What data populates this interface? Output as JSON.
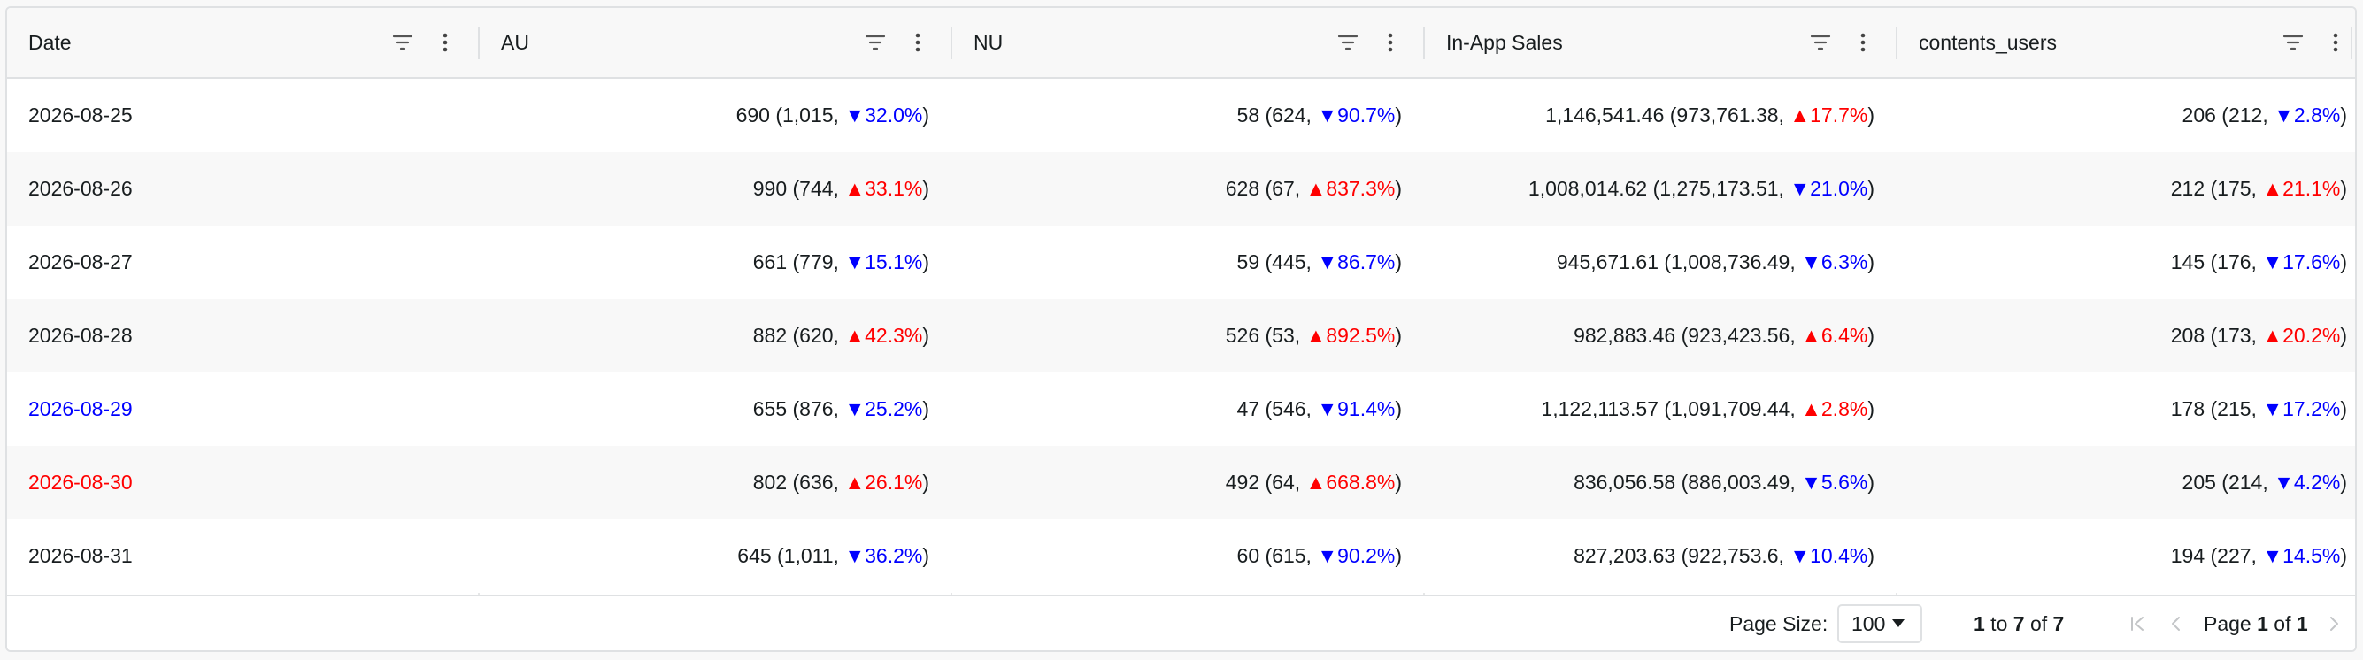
{
  "columns": [
    {
      "label": "Date"
    },
    {
      "label": "AU"
    },
    {
      "label": "NU"
    },
    {
      "label": "In-App Sales"
    },
    {
      "label": "contents_users"
    }
  ],
  "rows": [
    {
      "date": "2026-08-25",
      "date_color": "",
      "cells": [
        {
          "base": "690 (1,015, ",
          "dir": "down",
          "arrow": "▼",
          "pct": "32.0%",
          "close": ")"
        },
        {
          "base": "58 (624, ",
          "dir": "down",
          "arrow": "▼",
          "pct": "90.7%",
          "close": ")"
        },
        {
          "base": "1,146,541.46 (973,761.38, ",
          "dir": "up",
          "arrow": "▲",
          "pct": "17.7%",
          "close": ")"
        },
        {
          "base": "206 (212, ",
          "dir": "down",
          "arrow": "▼",
          "pct": "2.8%",
          "close": ")"
        }
      ]
    },
    {
      "date": "2026-08-26",
      "date_color": "",
      "cells": [
        {
          "base": "990 (744, ",
          "dir": "up",
          "arrow": "▲",
          "pct": "33.1%",
          "close": ")"
        },
        {
          "base": "628 (67, ",
          "dir": "up",
          "arrow": "▲",
          "pct": "837.3%",
          "close": ")"
        },
        {
          "base": "1,008,014.62 (1,275,173.51, ",
          "dir": "down",
          "arrow": "▼",
          "pct": "21.0%",
          "close": ")"
        },
        {
          "base": "212 (175, ",
          "dir": "up",
          "arrow": "▲",
          "pct": "21.1%",
          "close": ")"
        }
      ]
    },
    {
      "date": "2026-08-27",
      "date_color": "",
      "cells": [
        {
          "base": "661 (779, ",
          "dir": "down",
          "arrow": "▼",
          "pct": "15.1%",
          "close": ")"
        },
        {
          "base": "59 (445, ",
          "dir": "down",
          "arrow": "▼",
          "pct": "86.7%",
          "close": ")"
        },
        {
          "base": "945,671.61 (1,008,736.49, ",
          "dir": "down",
          "arrow": "▼",
          "pct": "6.3%",
          "close": ")"
        },
        {
          "base": "145 (176, ",
          "dir": "down",
          "arrow": "▼",
          "pct": "17.6%",
          "close": ")"
        }
      ]
    },
    {
      "date": "2026-08-28",
      "date_color": "",
      "cells": [
        {
          "base": "882 (620, ",
          "dir": "up",
          "arrow": "▲",
          "pct": "42.3%",
          "close": ")"
        },
        {
          "base": "526 (53, ",
          "dir": "up",
          "arrow": "▲",
          "pct": "892.5%",
          "close": ")"
        },
        {
          "base": "982,883.46 (923,423.56, ",
          "dir": "up",
          "arrow": "▲",
          "pct": "6.4%",
          "close": ")"
        },
        {
          "base": "208 (173, ",
          "dir": "up",
          "arrow": "▲",
          "pct": "20.2%",
          "close": ")"
        }
      ]
    },
    {
      "date": "2026-08-29",
      "date_color": "blue",
      "cells": [
        {
          "base": "655 (876, ",
          "dir": "down",
          "arrow": "▼",
          "pct": "25.2%",
          "close": ")"
        },
        {
          "base": "47 (546, ",
          "dir": "down",
          "arrow": "▼",
          "pct": "91.4%",
          "close": ")"
        },
        {
          "base": "1,122,113.57 (1,091,709.44, ",
          "dir": "up",
          "arrow": "▲",
          "pct": "2.8%",
          "close": ")"
        },
        {
          "base": "178 (215, ",
          "dir": "down",
          "arrow": "▼",
          "pct": "17.2%",
          "close": ")"
        }
      ]
    },
    {
      "date": "2026-08-30",
      "date_color": "red",
      "cells": [
        {
          "base": "802 (636, ",
          "dir": "up",
          "arrow": "▲",
          "pct": "26.1%",
          "close": ")"
        },
        {
          "base": "492 (64, ",
          "dir": "up",
          "arrow": "▲",
          "pct": "668.8%",
          "close": ")"
        },
        {
          "base": "836,056.58 (886,003.49, ",
          "dir": "down",
          "arrow": "▼",
          "pct": "5.6%",
          "close": ")"
        },
        {
          "base": "205 (214, ",
          "dir": "down",
          "arrow": "▼",
          "pct": "4.2%",
          "close": ")"
        }
      ]
    },
    {
      "date": "2026-08-31",
      "date_color": "",
      "cells": [
        {
          "base": "645 (1,011, ",
          "dir": "down",
          "arrow": "▼",
          "pct": "36.2%",
          "close": ")"
        },
        {
          "base": "60 (615, ",
          "dir": "down",
          "arrow": "▼",
          "pct": "90.2%",
          "close": ")"
        },
        {
          "base": "827,203.63 (922,753.6, ",
          "dir": "down",
          "arrow": "▼",
          "pct": "10.4%",
          "close": ")"
        },
        {
          "base": "194 (227, ",
          "dir": "down",
          "arrow": "▼",
          "pct": "14.5%",
          "close": ")"
        }
      ]
    }
  ],
  "footer": {
    "page_size_label": "Page Size:",
    "page_size_value": "100",
    "range_first": "1",
    "range_to": " to ",
    "range_last": "7",
    "range_of": " of ",
    "range_total": "7",
    "page_prefix": "Page ",
    "page_current": "1",
    "page_of": " of ",
    "page_total": "1"
  },
  "colors": {
    "up": "#ff0000",
    "down": "#0000ff",
    "date_blue": "#0000ff",
    "date_red": "#ff0000",
    "border": "#dfe1e3",
    "header_bg": "#f8f8f8"
  },
  "icons": {
    "filter": "filter-icon",
    "menu": "vertical-dots-menu-icon",
    "first_page": "first-page-icon",
    "prev_page": "previous-page-icon",
    "next_page": "next-page-icon"
  }
}
